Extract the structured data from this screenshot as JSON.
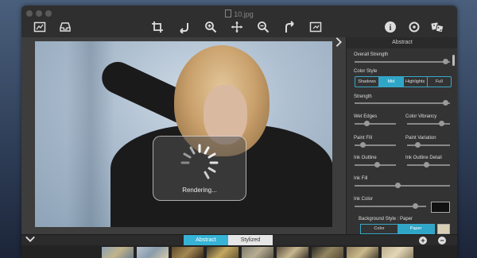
{
  "window": {
    "title": "10.jpg"
  },
  "toolbar": {
    "left_icons": [
      "compare-icon",
      "tray-icon"
    ],
    "center_icons": [
      "crop-icon",
      "undo-icon",
      "zoom-in-icon",
      "move-icon",
      "zoom-out-icon",
      "redo-icon",
      "fit-screen-icon"
    ],
    "right_icons": [
      "info-icon",
      "settings-icon",
      "effects-icon"
    ]
  },
  "canvas": {
    "status": "Rendering..."
  },
  "panel": {
    "title": "Abstract",
    "overall_strength": "Overall Strength",
    "color_style": {
      "label": "Color Style",
      "options": [
        "Shadows",
        "Mid",
        "Highlights",
        "Full"
      ],
      "selected": "Mid"
    },
    "strength": "Strength",
    "wet_edges": "Wet Edges",
    "color_vibrancy": "Color Vibrancy",
    "paint_fill": "Paint Fill",
    "paint_variation": "Paint Variation",
    "ink_outline": "Ink Outline",
    "ink_outline_detail": "Ink Outline Detail",
    "ink_fill": "Ink Fill",
    "ink_color": "Ink Color",
    "background_style": {
      "label": "Background Style : Paper",
      "options": [
        "Color",
        "Paper"
      ],
      "selected": "Paper"
    },
    "slider_levels": {
      "overall_strength": 0.95,
      "strength": 0.95,
      "wet_edges": 0.3,
      "color_vibrancy": 0.8,
      "paint_fill": 0.2,
      "paint_variation": 0.25,
      "ink_outline": 0.55,
      "ink_outline_detail": 0.45,
      "ink_fill": 0.45,
      "ink_color": 0.85
    }
  },
  "bottom": {
    "tabs": [
      "Abstract",
      "Stylized"
    ],
    "active_tab": "Abstract"
  },
  "colors": {
    "accent": "#36b3d5"
  }
}
